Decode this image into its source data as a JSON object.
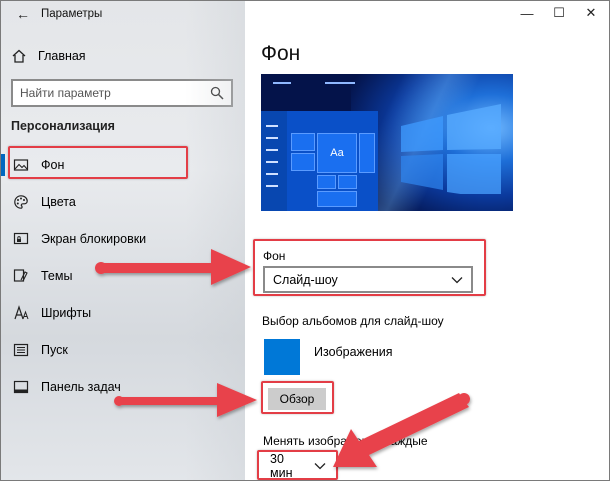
{
  "window": {
    "title": "Параметры",
    "controls": {
      "minimize": "—",
      "maximize": "☐",
      "close": "✕"
    }
  },
  "sidebar": {
    "back_glyph": "←",
    "home_label": "Главная",
    "search_placeholder": "Найти параметр",
    "section_title": "Персонализация",
    "items": [
      {
        "label": "Фон",
        "icon": "image-icon",
        "active": true
      },
      {
        "label": "Цвета",
        "icon": "palette-icon"
      },
      {
        "label": "Экран блокировки",
        "icon": "lock-screen-icon"
      },
      {
        "label": "Темы",
        "icon": "themes-icon"
      },
      {
        "label": "Шрифты",
        "icon": "font-icon"
      },
      {
        "label": "Пуск",
        "icon": "start-icon"
      },
      {
        "label": "Панель задач",
        "icon": "taskbar-icon"
      }
    ]
  },
  "main": {
    "title": "Фон",
    "preview_tile_label": "Aa",
    "background_label": "Фон",
    "background_value": "Слайд-шоу",
    "albums_label": "Выбор альбомов для слайд-шоу",
    "album_name": "Изображения",
    "browse_label": "Обзор",
    "change_label": "Менять изображение каждые",
    "interval_value": "30 мин"
  },
  "colors": {
    "accent": "#0078d7",
    "annotation": "#e33d46"
  }
}
